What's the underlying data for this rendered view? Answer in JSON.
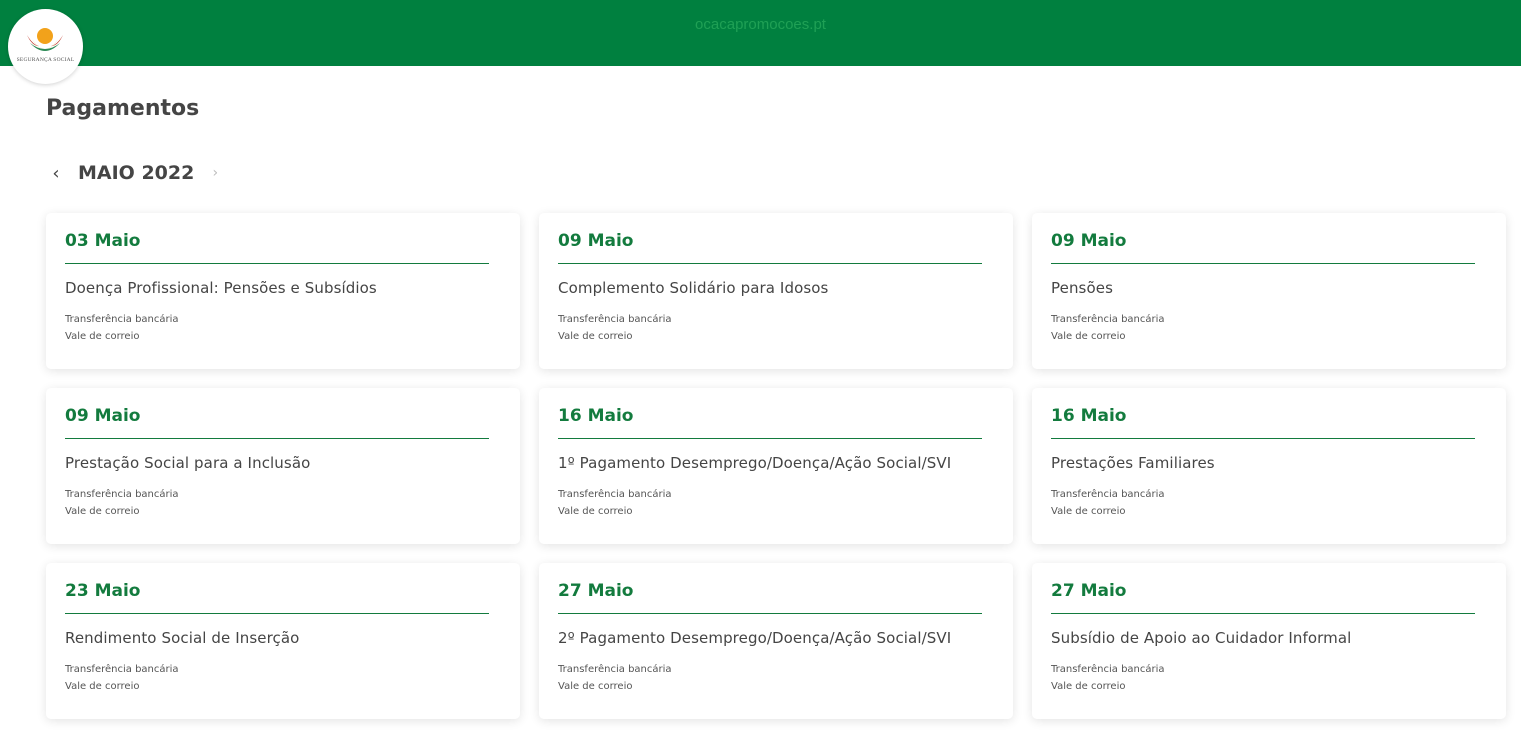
{
  "header": {
    "domain": "ocacapromocoes.pt",
    "logo_text": "SEGURANÇA SOCIAL",
    "brand_color": "#00803f"
  },
  "page": {
    "title": "Pagamentos"
  },
  "calendar": {
    "month_label": "MAIO 2022",
    "prev_icon": "chevron-left-icon",
    "next_icon": "chevron-right-icon"
  },
  "payments": [
    {
      "date": "03 Maio",
      "title": "Doença Profissional: Pensões e Subsídios",
      "methods": [
        "Transferência bancária",
        "Vale de correio"
      ]
    },
    {
      "date": "09 Maio",
      "title": "Complemento Solidário para Idosos",
      "methods": [
        "Transferência bancária",
        "Vale de correio"
      ]
    },
    {
      "date": "09 Maio",
      "title": "Pensões",
      "methods": [
        "Transferência bancária",
        "Vale de correio"
      ]
    },
    {
      "date": "09 Maio",
      "title": "Prestação Social para a Inclusão",
      "methods": [
        "Transferência bancária",
        "Vale de correio"
      ]
    },
    {
      "date": "16 Maio",
      "title": "1º Pagamento Desemprego/Doença/Ação Social/SVI",
      "methods": [
        "Transferência bancária",
        "Vale de correio"
      ]
    },
    {
      "date": "16 Maio",
      "title": "Prestações Familiares",
      "methods": [
        "Transferência bancária",
        "Vale de correio"
      ]
    },
    {
      "date": "23 Maio",
      "title": "Rendimento Social de Inserção",
      "methods": [
        "Transferência bancária",
        "Vale de correio"
      ]
    },
    {
      "date": "27 Maio",
      "title": "2º Pagamento Desemprego/Doença/Ação Social/SVI",
      "methods": [
        "Transferência bancária",
        "Vale de correio"
      ]
    },
    {
      "date": "27 Maio",
      "title": "Subsídio de Apoio ao Cuidador Informal",
      "methods": [
        "Transferência bancária",
        "Vale de correio"
      ]
    }
  ],
  "colors": {
    "accent": "#137b3e",
    "text": "#454545"
  }
}
